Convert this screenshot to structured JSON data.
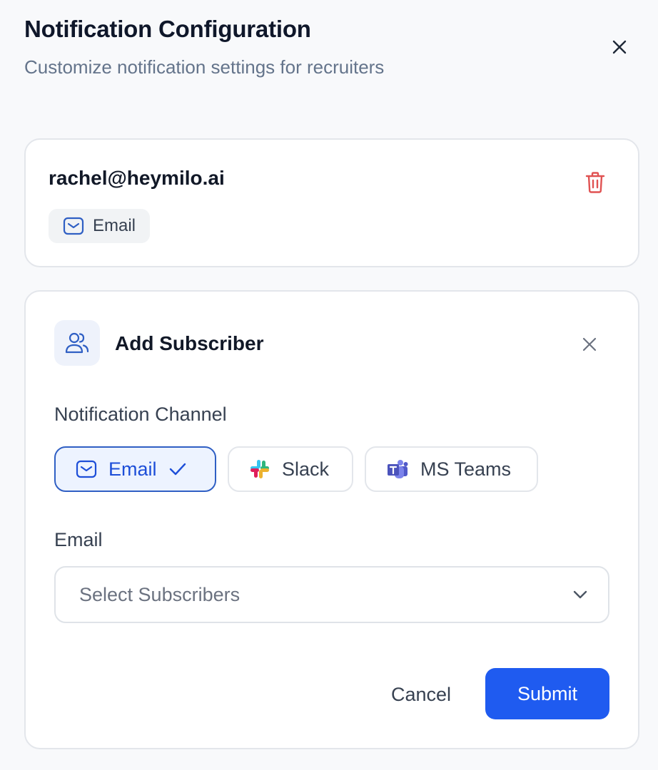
{
  "header": {
    "title": "Notification Configuration",
    "subtitle": "Customize notification settings for recruiters",
    "close_icon": "close-icon"
  },
  "subscriber": {
    "email": "rachel@heymilo.ai",
    "channel_label": "Email",
    "channel_icon": "mail-icon",
    "delete_icon": "trash-icon",
    "delete_color": "#e05252"
  },
  "add_subscriber": {
    "title": "Add Subscriber",
    "icon": "users-icon",
    "close_icon": "close-icon",
    "channel_section_label": "Notification Channel",
    "channels": [
      {
        "label": "Email",
        "icon": "mail-icon",
        "selected": true
      },
      {
        "label": "Slack",
        "icon": "slack-icon",
        "selected": false
      },
      {
        "label": "MS Teams",
        "icon": "ms-teams-icon",
        "selected": false
      }
    ],
    "email_field_label": "Email",
    "select_placeholder": "Select Subscribers",
    "cancel_label": "Cancel",
    "submit_label": "Submit"
  },
  "colors": {
    "accent": "#1f5bf0",
    "selected_border": "#2f5fc4",
    "selected_bg": "#edf3ff"
  }
}
